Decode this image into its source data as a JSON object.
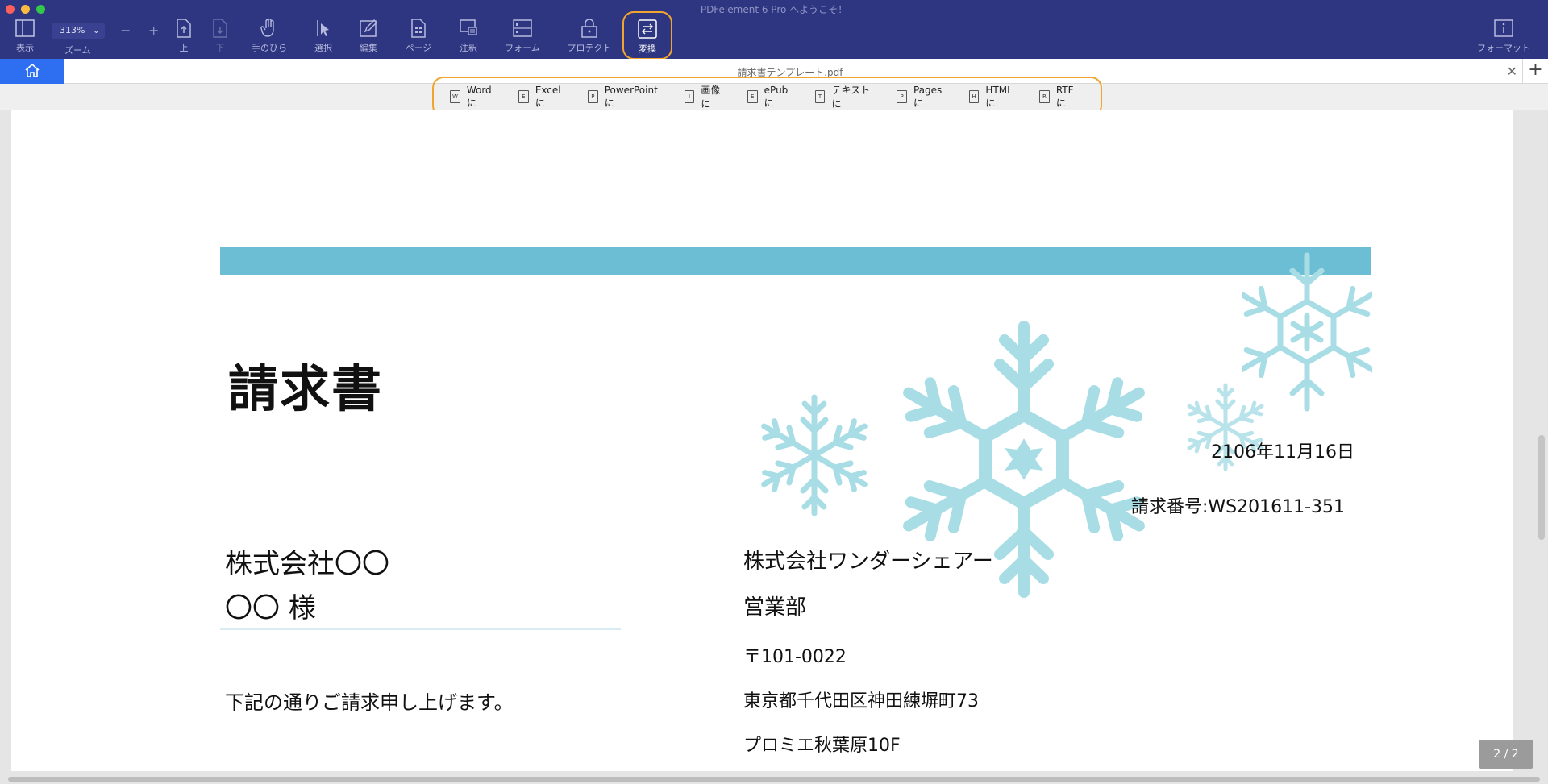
{
  "window": {
    "title": "PDFelement 6 Pro へようこそ！"
  },
  "toolbar": {
    "display": "表示",
    "zoom_value": "313%",
    "zoom_label": "ズーム",
    "zoom_out": "−",
    "zoom_in": "+",
    "up": "上",
    "down": "下",
    "hand": "手のひら",
    "select": "選択",
    "edit": "編集",
    "page": "ページ",
    "comment": "注釈",
    "form": "フォーム",
    "protect": "プロテクト",
    "convert": "変換",
    "format": "フォーマット"
  },
  "tab": {
    "filename": "請求書テンプレート.pdf",
    "close": "✕",
    "add": "+"
  },
  "convert_bar": {
    "items": [
      {
        "label": "Wordに",
        "icon": "W"
      },
      {
        "label": "Excelに",
        "icon": "E"
      },
      {
        "label": "PowerPointに",
        "icon": "P"
      },
      {
        "label": "画像に",
        "icon": "I"
      },
      {
        "label": "ePubに",
        "icon": "E"
      },
      {
        "label": "テキストに",
        "icon": "T"
      },
      {
        "label": "Pagesに",
        "icon": "P"
      },
      {
        "label": "HTMLに",
        "icon": "H"
      },
      {
        "label": "RTFに",
        "icon": "R"
      }
    ]
  },
  "document": {
    "title": "請求書",
    "date": "2106年11月16日",
    "invoice_no": "請求番号:WS201611-351",
    "client_company": "株式会社〇〇",
    "client_honorific": "〇〇 様",
    "note": "下記の通りご請求申し上げます。",
    "seller_company": "株式会社ワンダーシェアー",
    "seller_department": "営業部",
    "seller_zip": "〒101-0022",
    "seller_address": "東京都千代田区神田練塀町73",
    "seller_building": "プロミエ秋葉原10F"
  },
  "page_indicator": "2 / 2",
  "colors": {
    "toolbar": "#2e3581",
    "accent": "#2d6ff0",
    "highlight": "#f0a62e",
    "snow": "#a8dde6"
  }
}
